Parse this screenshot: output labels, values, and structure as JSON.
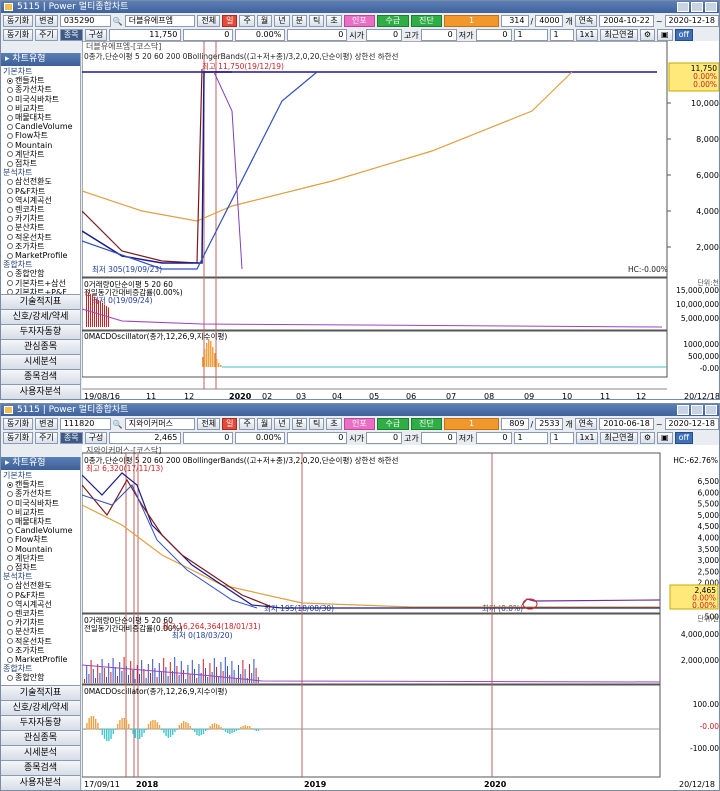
{
  "window1": {
    "title": "5115 | Power 멀티종합차트",
    "row1": {
      "dong": "동기화",
      "byeon": "변경",
      "code": "035290",
      "name": "더블유에프엠",
      "all": "전체",
      "il": "일",
      "ju": "주",
      "wol": "월",
      "nyeon": "년",
      "bun": "분",
      "tik": "틱",
      "cho": "초",
      "info": "인포",
      "sugeup": "수급",
      "jindan": "진단",
      "num1": "1",
      "count": "314",
      "slash": "4000",
      "unit": "개",
      "cont": "연속",
      "date_from": "2004-10-22",
      "tilde": "~",
      "date_to": "2020-12-18"
    },
    "row2": {
      "dong": "동기화",
      "ju": "주기",
      "jong": "종목",
      "gu": "구성",
      "price": "11,750",
      "chg": "0",
      "pct": "0.00%",
      "vol": "0",
      "si": "시가",
      "si_v": "0",
      "go": "고가",
      "go_v": "0",
      "jeo": "저가",
      "jeo_v": "0",
      "box1": "1",
      "box2": "1",
      "x1": "1x1",
      "latest": "최근연결",
      "off": "off"
    },
    "sidebar": {
      "header": "차트유형",
      "groups": [
        {
          "cat": "기본차트",
          "items": [
            "캔들차트",
            "종가선차트",
            "미국식바차트",
            "비교차트",
            "매물대차트",
            "CandleVolume",
            "Flow차트",
            "Mountain",
            "계단차트",
            "점차트"
          ]
        },
        {
          "cat": "분석차트",
          "items": [
            "삼선전환도",
            "P&F차트",
            "역시계곡선",
            "렌코차트",
            "카기차트",
            "분산차트",
            "적운선차트",
            "조가차트",
            "MarketProfile"
          ]
        },
        {
          "cat": "종합차트",
          "items": [
            "종합안함",
            "기본차트+삼선",
            "기본차트+P&F"
          ]
        }
      ],
      "checked": "캔들차트",
      "menu": [
        "기술적지표",
        "신호/강세/약세",
        "두자자동향",
        "관심종목",
        "시세분석",
        "종목검색",
        "사용자분석"
      ]
    },
    "chart": {
      "name_label": "더블유에프엠-[코스닥]",
      "legend": "0종가,단순이평 5 20 60 200 0BollingerBands((고+저+종)/3,2,0,20,단순이평) 상한선 하한선",
      "hi_label": "최고 11,750(19/12/19)",
      "lo_label": "최저 305(19/09/23)",
      "right_pct": "11,750\n0.00%\n0.00%",
      "hc": "HC:-0.00%",
      "price_ticks": [
        "10,000",
        "8,000",
        "6,000",
        "4,000",
        "2,000"
      ],
      "vol_legend": "0거래량0단순이평 5 20 60",
      "vol_sub": "전일동기간대비증감률(0.00%)",
      "vol_min": "최저 0(19/09/24)",
      "vol_ticks": [
        "15,000,000",
        "10,000,000",
        "5,000,000"
      ],
      "vol_unit": "단위:천",
      "macd_legend": "0MACDOscillator(종가,12,26,9,지수이평)",
      "macd_ticks": [
        "1000,000",
        "500,000",
        "-0.00"
      ],
      "x_ticks": [
        "19/08/16",
        "11",
        "12",
        "2020",
        "02",
        "03",
        "04",
        "05",
        "06",
        "07",
        "08",
        "09",
        "10",
        "11",
        "12",
        "20/12/18"
      ]
    }
  },
  "window2": {
    "title": "5115 | Power 멀티종합차트",
    "row1": {
      "dong": "동기화",
      "byeon": "변경",
      "code": "111820",
      "name": "지와이커머스",
      "all": "전체",
      "il": "일",
      "ju": "주",
      "wol": "월",
      "nyeon": "년",
      "bun": "분",
      "tik": "틱",
      "cho": "초",
      "info": "인포",
      "sugeup": "수급",
      "jindan": "진단",
      "num1": "1",
      "count": "809",
      "slash": "2533",
      "unit": "개",
      "cont": "연속",
      "date_from": "2010-06-18",
      "tilde": "~",
      "date_to": "2020-12-18"
    },
    "row2": {
      "dong": "동기화",
      "ju": "주기",
      "jong": "종목",
      "gu": "구성",
      "price": "2,465",
      "chg": "0",
      "pct": "0.00%",
      "vol": "0",
      "si": "시가",
      "si_v": "0",
      "go": "고가",
      "go_v": "0",
      "jeo": "저가",
      "jeo_v": "0",
      "box1": "1",
      "box2": "1",
      "x1": "1x1",
      "latest": "최근연결",
      "off": "off"
    },
    "sidebar": {
      "header": "차트유형",
      "groups": [
        {
          "cat": "기본차트",
          "items": [
            "캔들차트",
            "종가선차트",
            "미국식바차트",
            "비교차트",
            "매물대차트",
            "CandleVolume",
            "Flow차트",
            "Mountain",
            "계단차트",
            "점차트"
          ]
        },
        {
          "cat": "분석차트",
          "items": [
            "삼선전환도",
            "P&F차트",
            "역시계곡선",
            "렌코차트",
            "카기차트",
            "분산차트",
            "적운선차트",
            "조가차트",
            "MarketProfile"
          ]
        },
        {
          "cat": "종합차트",
          "items": [
            "종합안함"
          ]
        }
      ],
      "checked": "캔들차트",
      "menu": [
        "기술적지표",
        "신호/강세/약세",
        "두자자동향",
        "관심종목",
        "시세분석",
        "종목검색",
        "사용자분석"
      ]
    },
    "chart": {
      "name_label": "지와이커머스-[코스닥]",
      "legend": "0종가,단순이평 5 20 60 200 0BollingerBands((고+저+종)/3,2,0,20,단순이평) 상한선 하한선",
      "hi_label": "최고 6,320(17/11/13)",
      "lo_label": "최저 195(18/08/30)",
      "cur_label": "최저 (0.0%)",
      "right_pct": "2,465\n0.00%\n0.00%",
      "hc": "HC:-62.76%",
      "price_ticks": [
        "6,500",
        "6,000",
        "5,500",
        "5,000",
        "4,500",
        "4,000",
        "3,500",
        "3,000",
        "2,500",
        "2,000",
        "1,500",
        "1,000",
        "500"
      ],
      "vol_legend": "0거래량0단순이평 5 20 60",
      "vol_sub": "전일동기간대비증감률(0.00%)",
      "vol_max": "최고 16,264,364(18/01/31)",
      "vol_min": "최저 0(18/03/20)",
      "vol_ticks": [
        "4,000,000",
        "2,000,000"
      ],
      "vol_unit": "단위:천",
      "macd_legend": "0MACDOscillator(종가,12,26,9,지수이평)",
      "macd_ticks": [
        "100.00",
        "-0.00",
        "-100.00"
      ],
      "x_ticks": [
        "17/09/11",
        "2018",
        "2019",
        "2020",
        "20/12/18"
      ]
    }
  }
}
